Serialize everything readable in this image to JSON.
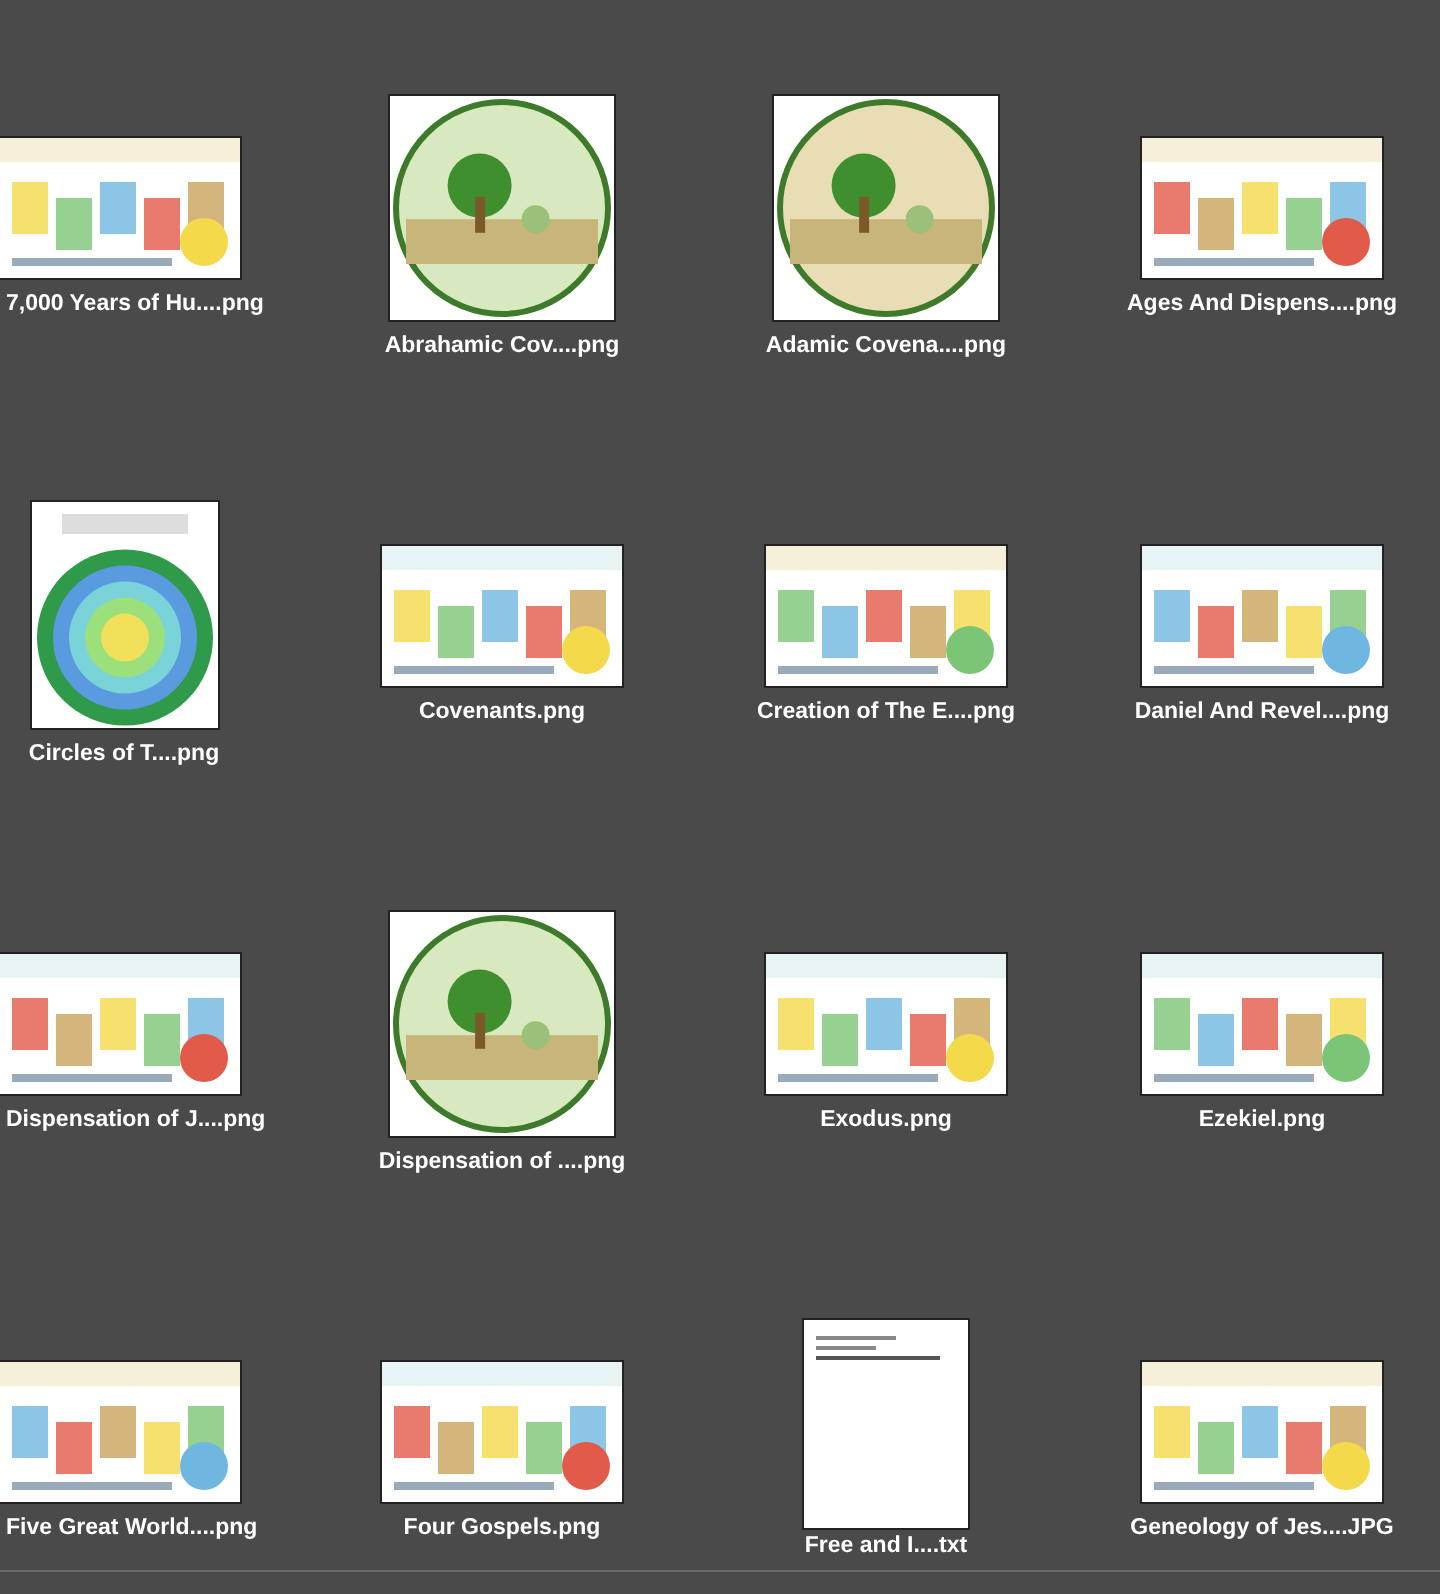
{
  "files": [
    {
      "name": "7,000 Years of Hu....png",
      "kind": "wide"
    },
    {
      "name": "Abrahamic Cov....png",
      "kind": "square"
    },
    {
      "name": "Adamic Covena....png",
      "kind": "square"
    },
    {
      "name": "Ages And Dispens....png",
      "kind": "wide"
    },
    {
      "name": "Circles of T....png",
      "kind": "tall"
    },
    {
      "name": "Covenants.png",
      "kind": "wide"
    },
    {
      "name": "Creation of The E....png",
      "kind": "wide"
    },
    {
      "name": "Daniel And Revel....png",
      "kind": "wide"
    },
    {
      "name": "Dispensation of J....png",
      "kind": "wide"
    },
    {
      "name": "Dispensation of ....png",
      "kind": "square"
    },
    {
      "name": "Exodus.png",
      "kind": "wide"
    },
    {
      "name": "Ezekiel.png",
      "kind": "wide"
    },
    {
      "name": "Five Great World....png",
      "kind": "wide"
    },
    {
      "name": "Four Gospels.png",
      "kind": "wide"
    },
    {
      "name": "Free and I....txt",
      "kind": "page"
    },
    {
      "name": "Geneology of Jes....JPG",
      "kind": "wide"
    }
  ]
}
